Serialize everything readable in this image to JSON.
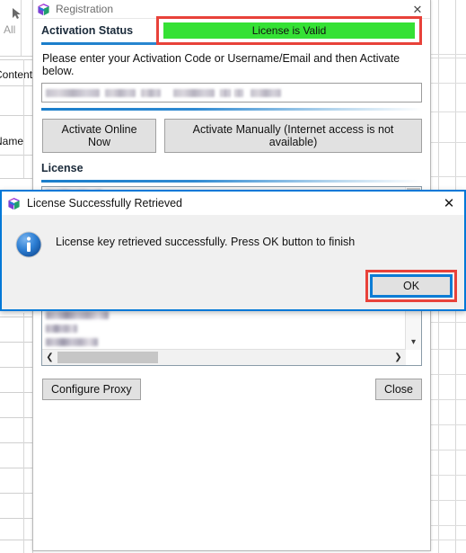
{
  "background": {
    "name": "spreadsheet-behind",
    "left_panel": {
      "tool_icon": "cursor-arrow-icon",
      "all_label": "All",
      "contents_label": "Contents",
      "name_label": "Name"
    }
  },
  "registration_window": {
    "title": "Registration",
    "icon": "app-cube-icon",
    "close_icon": "close-icon",
    "activation": {
      "label": "Activation Status",
      "status_text": "License is Valid",
      "status_color": "#35e135",
      "highlight_color": "#e8423a"
    },
    "hint": "Please enter your Activation Code or Username/Email and then Activate below.",
    "activation_code_input": {
      "value": "",
      "placeholder": "",
      "redacted": true
    },
    "buttons": {
      "activate_online": "Activate Online Now",
      "activate_manually": "Activate Manually (Internet access is not available)"
    },
    "license_section": {
      "heading": "License",
      "rows_redacted": true,
      "row_widths": [
        62,
        368,
        42,
        40,
        52,
        78,
        84,
        112,
        104,
        70,
        35,
        58,
        372
      ],
      "v_scrollbar": "vertical-scrollbar",
      "h_scrollbar": "horizontal-scrollbar",
      "scroll_down_icon": "chevron-down-icon",
      "scroll_left_icon": "chevron-left-icon",
      "scroll_right_icon": "chevron-right-icon"
    },
    "footer": {
      "configure_proxy": "Configure Proxy",
      "close": "Close"
    }
  },
  "modal": {
    "title": "License Successfully Retrieved",
    "icon": "app-cube-icon",
    "close_icon": "close-icon",
    "info_icon": "info-icon",
    "message": "License key retrieved successfully. Press OK button to finish",
    "ok_label": "OK",
    "ok_highlight_color": "#e8423a",
    "ok_focus_color": "#0c7cd5",
    "border_color": "#0078d7"
  }
}
